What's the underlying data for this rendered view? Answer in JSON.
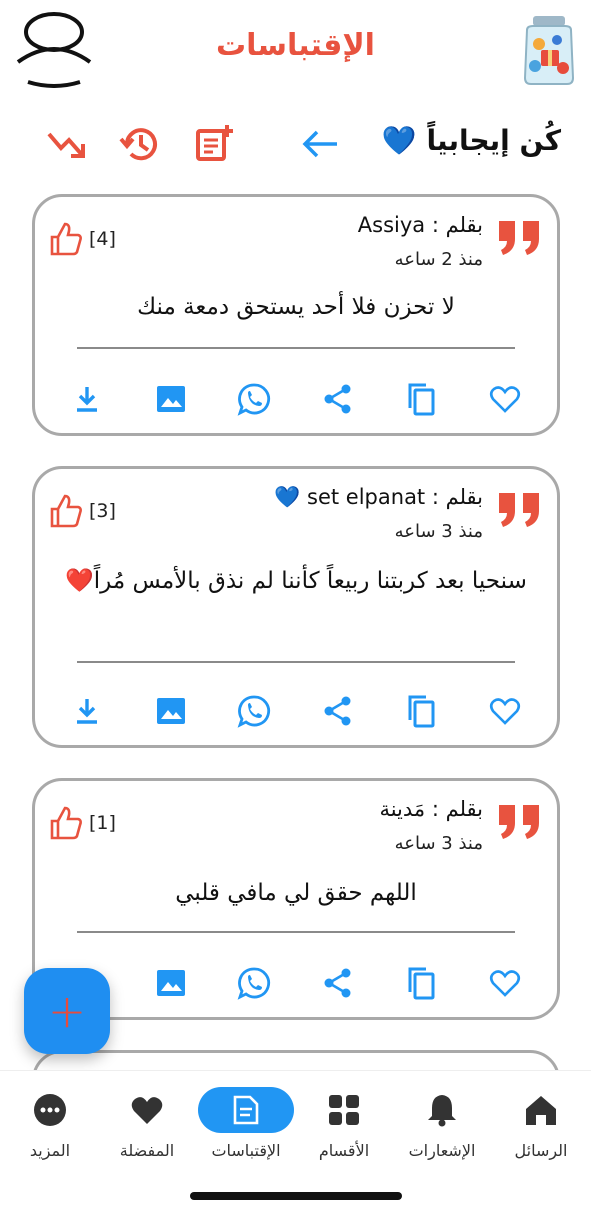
{
  "header": {
    "title": "الإقتباسات",
    "avatar_icon": "user-avatar-icon",
    "logo_icon": "app-jar-logo-icon"
  },
  "toolbar": {
    "heading": "كُن إيجابياً 💙",
    "icons": [
      "trending-down-icon",
      "history-icon",
      "add-note-icon",
      "arrow-left-icon"
    ]
  },
  "colors": {
    "accent_red": "#e8533f",
    "accent_blue": "#2196f3",
    "card_border": "#a9a9a9"
  },
  "quotes": [
    {
      "author": "بقلم : Assiya",
      "time": "منذ 2 ساعه",
      "likes": "[4]",
      "text": "لا تحزن فلا أحد يستحق دمعة منك"
    },
    {
      "author": "بقلم : set elpanat 💙",
      "time": "منذ 3 ساعه",
      "likes": "[3]",
      "text": "سنحيا بعد كربتنا ربيعاً كأننا لم نذق بالأمس مُراً❤️"
    },
    {
      "author": "بقلم : مَدينة",
      "time": "منذ 3 ساعه",
      "likes": "[1]",
      "text": "اللهم حقق لي مافي قلبي"
    }
  ],
  "card_actions": [
    "download-icon",
    "image-icon",
    "whatsapp-icon",
    "share-icon",
    "copy-icon",
    "heart-outline-icon"
  ],
  "fab": {
    "label": "+"
  },
  "nav": {
    "items": [
      {
        "label": "المزيد",
        "icon": "more-dots-icon"
      },
      {
        "label": "المفضلة",
        "icon": "heart-icon"
      },
      {
        "label": "الإقتباسات",
        "icon": "quotes-doc-icon"
      },
      {
        "label": "الأقسام",
        "icon": "grid-icon"
      },
      {
        "label": "الإشعارات",
        "icon": "bell-icon"
      },
      {
        "label": "الرسائل",
        "icon": "home-icon"
      }
    ],
    "active_index": 2
  }
}
